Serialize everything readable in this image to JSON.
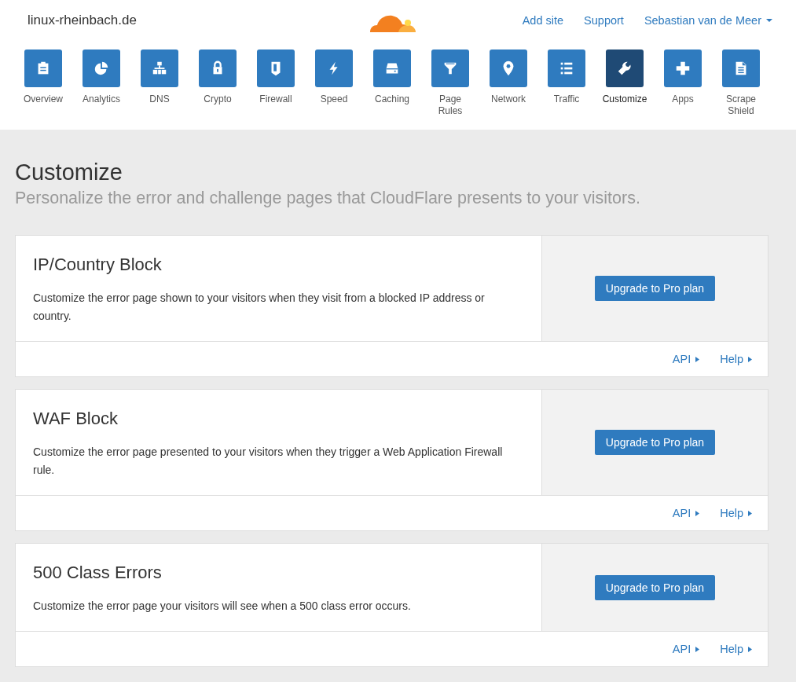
{
  "header": {
    "domain": "linux-rheinbach.de",
    "links": [
      "Add site",
      "Support"
    ],
    "user_menu": "Sebastian van de Meer"
  },
  "nav": [
    {
      "label": "Overview",
      "selected": false
    },
    {
      "label": "Analytics",
      "selected": false
    },
    {
      "label": "DNS",
      "selected": false
    },
    {
      "label": "Crypto",
      "selected": false
    },
    {
      "label": "Firewall",
      "selected": false
    },
    {
      "label": "Speed",
      "selected": false
    },
    {
      "label": "Caching",
      "selected": false
    },
    {
      "label": "Page Rules",
      "selected": false
    },
    {
      "label": "Network",
      "selected": false
    },
    {
      "label": "Traffic",
      "selected": false
    },
    {
      "label": "Customize",
      "selected": true
    },
    {
      "label": "Apps",
      "selected": false
    },
    {
      "label": "Scrape Shield",
      "selected": false
    }
  ],
  "page": {
    "title": "Customize",
    "subtitle": "Personalize the error and challenge pages that CloudFlare presents to your visitors."
  },
  "cards": [
    {
      "title": "IP/Country Block",
      "description": "Customize the error page shown to your visitors when they visit from a blocked IP address or country.",
      "button": "Upgrade to Pro plan",
      "links": [
        "API",
        "Help"
      ]
    },
    {
      "title": "WAF Block",
      "description": "Customize the error page presented to your visitors when they trigger a Web Application Firewall rule.",
      "button": "Upgrade to Pro plan",
      "links": [
        "API",
        "Help"
      ]
    },
    {
      "title": "500 Class Errors",
      "description": "Customize the error page your visitors will see when a 500 class error occurs.",
      "button": "Upgrade to Pro plan",
      "links": [
        "API",
        "Help"
      ]
    }
  ]
}
